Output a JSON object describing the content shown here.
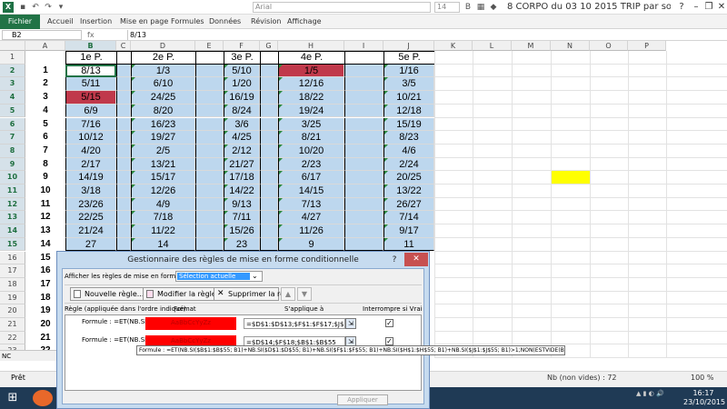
{
  "titlebar": {
    "logo": "X",
    "font_name": "Arial",
    "font_size": "14",
    "title": "8 CORPO du 03 10 2015 TRIP par soc...",
    "help": "?",
    "minimize": "–",
    "restore": "❐",
    "close": "✕"
  },
  "ribbon": {
    "tabs": [
      "Fichier",
      "Accueil",
      "Insertion",
      "Mise en page",
      "Formules",
      "Données",
      "Révision",
      "Affichage"
    ]
  },
  "formula_bar": {
    "name_box": "B2",
    "fx": "fx",
    "formula": "8/13"
  },
  "columns": [
    "A",
    "B",
    "C",
    "D",
    "E",
    "F",
    "G",
    "H",
    "I",
    "J",
    "K",
    "L",
    "M",
    "N",
    "O",
    "P"
  ],
  "rows": [
    "1",
    "2",
    "3",
    "4",
    "5",
    "6",
    "7",
    "8",
    "9",
    "10",
    "11",
    "12",
    "13",
    "14",
    "15",
    "16",
    "17",
    "18",
    "19",
    "20",
    "21",
    "22",
    "23"
  ],
  "sheet": {
    "headers": [
      "1e P.",
      "2e P.",
      "3e P.",
      "4e P.",
      "5e P."
    ],
    "row_labels": [
      "1",
      "2",
      "3",
      "4",
      "5",
      "6",
      "7",
      "8",
      "9",
      "10",
      "11",
      "12",
      "13",
      "14",
      "15",
      "16",
      "17",
      "18",
      "19",
      "20",
      "21",
      "22",
      "23"
    ],
    "cols": [
      [
        "8/13",
        "5/11",
        "5/15",
        "6/9",
        "7/16",
        "10/12",
        "4/20",
        "2/17",
        "14/19",
        "3/18",
        "23/26",
        "22/25",
        "21/24",
        "27"
      ],
      [
        "1/3",
        "6/10",
        "24/25",
        "8/20",
        "16/23",
        "19/27",
        "2/5",
        "13/21",
        "15/17",
        "12/26",
        "4/9",
        "7/18",
        "11/22",
        "14"
      ],
      [
        "5/10",
        "1/20",
        "16/19",
        "8/24",
        "3/6",
        "4/25",
        "2/12",
        "21/27",
        "17/18",
        "14/22",
        "9/13",
        "7/11",
        "15/26",
        "23"
      ],
      [
        "1/5",
        "12/16",
        "18/22",
        "19/24",
        "3/25",
        "8/21",
        "10/20",
        "2/23",
        "6/17",
        "14/15",
        "7/13",
        "4/27",
        "11/26",
        "9"
      ],
      [
        "1/16",
        "3/5",
        "10/21",
        "12/18",
        "15/19",
        "8/23",
        "4/6",
        "2/24",
        "20/25",
        "13/22",
        "26/27",
        "7/14",
        "9/17",
        "11"
      ]
    ],
    "highlight_colors": {
      "red": "#c0394b",
      "yellow": "#ffff00",
      "blue": "#bdd7ee"
    }
  },
  "sheet_tab": "NC",
  "status": {
    "ready": "Prêt",
    "count": "Nb (non vides) : 72",
    "zoom": "100 %"
  },
  "taskbar": {
    "time": "16:17",
    "date": "23/10/2015",
    "hint": "cher"
  },
  "dialog": {
    "title": "Gestionnaire des règles de mise en forme conditionnelle",
    "help": "?",
    "close": "✕",
    "show_label": "Afficher les règles de mise en forme pour :",
    "show_value": "Sélection actuelle",
    "new_rule": "Nouvelle règle...",
    "edit_rule": "Modifier la règle...",
    "delete_rule": "Supprimer la règle",
    "col_rule": "Règle (appliquée dans l'ordre indiqué)",
    "col_format": "Format",
    "col_applies": "S'applique à",
    "col_stop": "Interrompre si Vrai",
    "rules": [
      {
        "rule": "Formule : =ET(NB.SI($B$1:$B$5...",
        "format": "AaBbCcYyZz",
        "applies": "=$D$1:$D$13;$F$1:$F$17;$J$1:$J$5",
        "stop": "✓"
      },
      {
        "rule": "Formule : =ET(NB.SI($B$1:$B$5...",
        "format": "AaBbCcYyZz",
        "applies": "=$D$14;$F$18;$B$1:$B$55",
        "stop": "✓"
      }
    ],
    "tooltip": "Formule : =ET(NB.SI($B$1:$B$55; B1)+NB.SI($D$1:$D$55; B1)+NB.SI($F$1:$F$55; B1)+NB.SI($H$1:$H$55; B1)+NB.SI($J$1:$J$55; B1)>1;NON(ESTVIDE(B1)))",
    "apply_btn": "Appliquer"
  }
}
